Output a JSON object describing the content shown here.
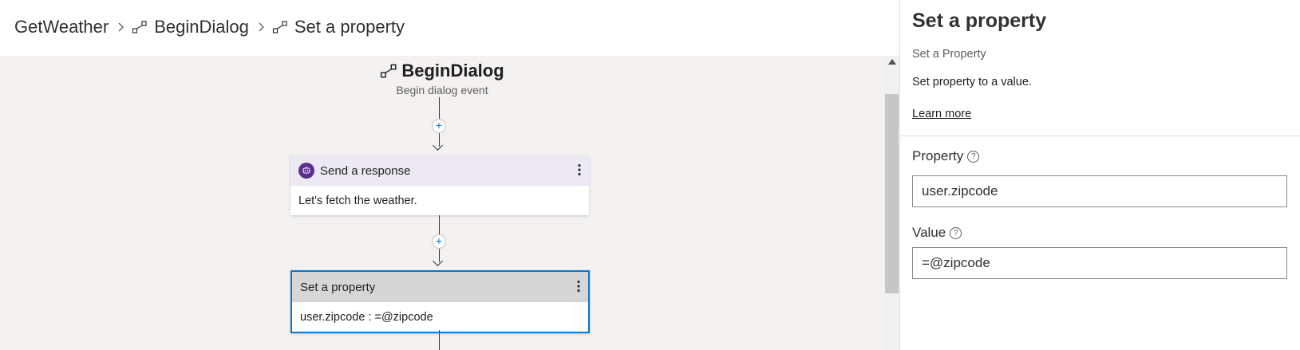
{
  "breadcrumb": {
    "items": [
      {
        "label": "GetWeather",
        "icon": ""
      },
      {
        "label": "BeginDialog",
        "icon": "event-trigger-icon"
      },
      {
        "label": "Set a property",
        "icon": "event-trigger-icon"
      }
    ],
    "separator_icon": "chevron-right-icon"
  },
  "canvas": {
    "trigger": {
      "title": "BeginDialog",
      "subtitle": "Begin dialog event",
      "icon": "event-trigger-icon"
    },
    "add_label": "+",
    "nodes": [
      {
        "title": "Send a response",
        "body": "Let's fetch the weather.",
        "icon": "bot-icon",
        "menu_icon": "more-vertical-icon"
      },
      {
        "title": "Set a property",
        "body": "user.zipcode : =@zipcode",
        "menu_icon": "more-vertical-icon",
        "selected": true
      }
    ]
  },
  "pane": {
    "title": "Set a property",
    "subtitle": "Set a Property",
    "description": "Set property to a value.",
    "learn_more": "Learn more",
    "fields": [
      {
        "label": "Property",
        "value": "user.zipcode",
        "help_icon": "help-circle-icon"
      },
      {
        "label": "Value",
        "value": "=@zipcode",
        "help_icon": "help-circle-icon"
      }
    ]
  },
  "colors": {
    "accent": "#0078d4",
    "bot_purple": "#5c2e91",
    "response_header": "#ece9f3",
    "selected_header": "#d6d6d6",
    "canvas_bg": "#f3f2f1"
  }
}
